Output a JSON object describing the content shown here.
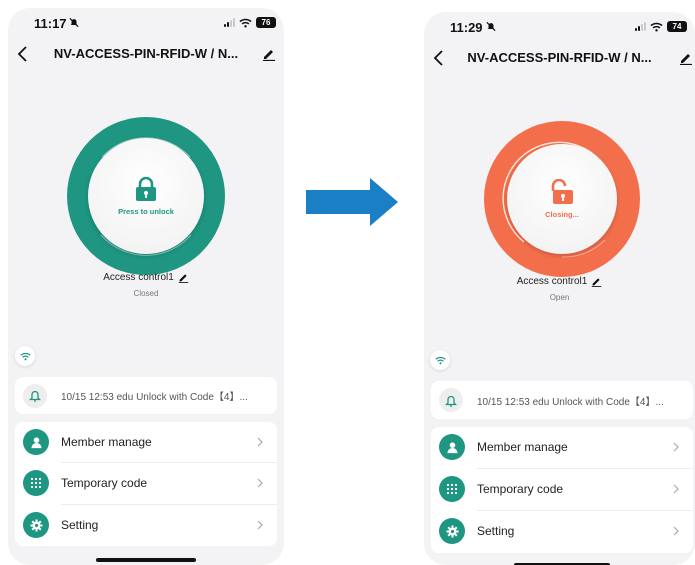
{
  "arrow_color": "#1a7fc4",
  "left": {
    "status_time": "11:17",
    "battery": "76",
    "nav_title": "NV-ACCESS-PIN-RFID-W / N...",
    "lock_color": "#1e9682",
    "lock_caption": "Press to unlock",
    "lock_state_icon": "locked-padlock-icon",
    "device_name": "Access control1",
    "device_status": "Closed",
    "log_text": "10/15 12:53 edu  Unlock with Code【4】...",
    "menu": [
      {
        "label": "Member manage",
        "icon": "person-icon"
      },
      {
        "label": "Temporary code",
        "icon": "keypad-icon"
      },
      {
        "label": "Setting",
        "icon": "gear-icon"
      }
    ]
  },
  "right": {
    "status_time": "11:29",
    "battery": "74",
    "nav_title": "NV-ACCESS-PIN-RFID-W / N...",
    "lock_color": "#f36f4c",
    "lock_caption": "Closing...",
    "lock_state_icon": "unlocked-padlock-icon",
    "device_name": "Access control1",
    "device_status": "Open",
    "log_text": "10/15 12:53 edu  Unlock with Code【4】...",
    "menu": [
      {
        "label": "Member manage",
        "icon": "person-icon"
      },
      {
        "label": "Temporary code",
        "icon": "keypad-icon"
      },
      {
        "label": "Setting",
        "icon": "gear-icon"
      }
    ]
  }
}
